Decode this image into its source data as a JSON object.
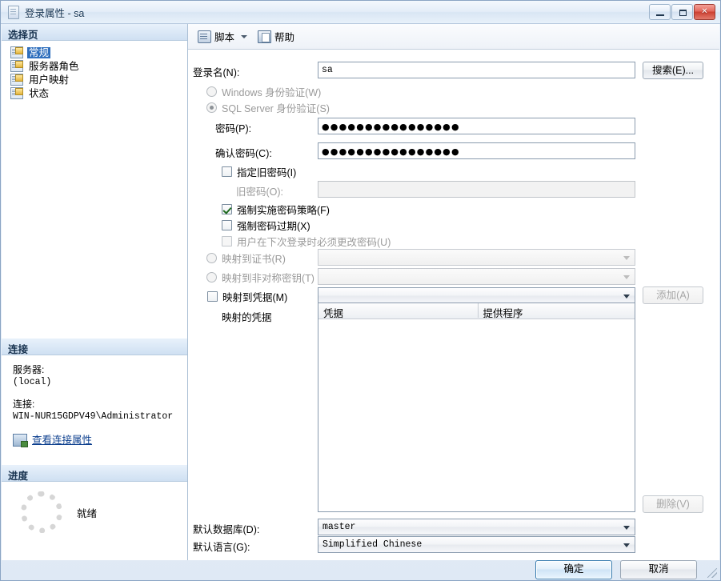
{
  "window": {
    "title": "登录属性 - sa",
    "icon": "document-icon",
    "controls": {
      "minimize": "最小化",
      "maximize": "最大化",
      "close": "关闭"
    }
  },
  "sidebar": {
    "select_page_header": "选择页",
    "items": [
      {
        "label": "常规",
        "selected": true
      },
      {
        "label": "服务器角色",
        "selected": false
      },
      {
        "label": "用户映射",
        "selected": false
      },
      {
        "label": "状态",
        "selected": false
      }
    ],
    "connection": {
      "header": "连接",
      "server_label": "服务器:",
      "server_value": "(local)",
      "connection_label": "连接:",
      "connection_value": "WIN-NUR15GDPV49\\Administrator",
      "view_properties_link": "查看连接属性"
    },
    "progress": {
      "header": "进度",
      "status": "就绪"
    }
  },
  "toolbar": {
    "script_label": "脚本",
    "help_label": "帮助"
  },
  "form": {
    "login_name_label": "登录名(N):",
    "login_name_value": "sa",
    "search_button": "搜索(E)...",
    "windows_auth_label": "Windows 身份验证(W)",
    "sql_auth_label": "SQL Server 身份验证(S)",
    "password_label": "密码(P):",
    "password_value": "●●●●●●●●●●●●●●●●",
    "confirm_password_label": "确认密码(C):",
    "confirm_password_value": "●●●●●●●●●●●●●●●●",
    "specify_old_password_label": "指定旧密码(I)",
    "old_password_label": "旧密码(O):",
    "old_password_value": "",
    "enforce_policy_label": "强制实施密码策略(F)",
    "enforce_expiration_label": "强制密码过期(X)",
    "must_change_label": "用户在下次登录时必须更改密码(U)",
    "map_certificate_label": "映射到证书(R)",
    "map_certificate_value": "",
    "map_asymmetric_label": "映射到非对称密钥(T)",
    "map_asymmetric_value": "",
    "map_credential_label": "映射到凭据(M)",
    "map_credential_value": "",
    "add_button": "添加(A)",
    "mapped_credentials_label": "映射的凭据",
    "credentials_columns": [
      "凭据",
      "提供程序"
    ],
    "credentials_rows": [],
    "remove_button": "删除(V)",
    "default_database_label": "默认数据库(D):",
    "default_database_value": "master",
    "default_language_label": "默认语言(G):",
    "default_language_value": "Simplified Chinese"
  },
  "footer": {
    "ok_button": "确定",
    "cancel_button": "取消"
  }
}
